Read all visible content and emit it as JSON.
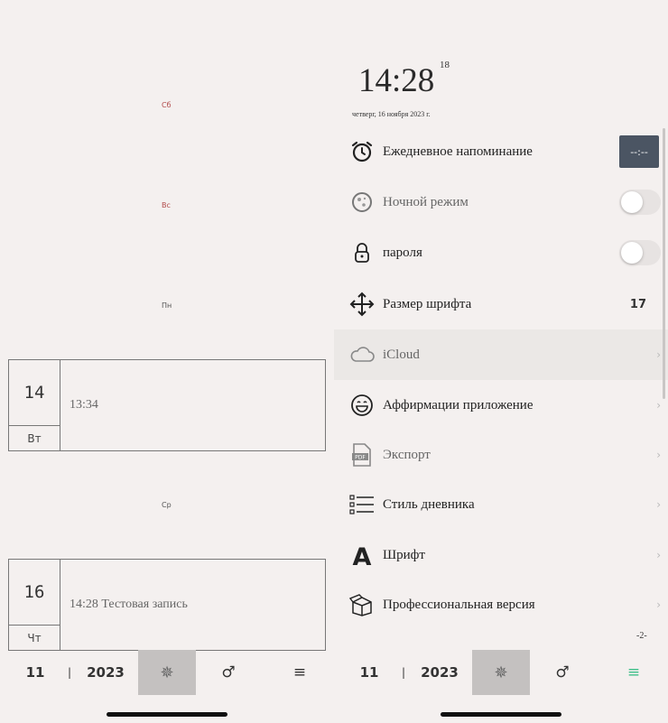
{
  "left": {
    "day_labels": [
      {
        "text": "Сб",
        "weekend": true
      },
      {
        "text": "Вс",
        "weekend": true
      },
      {
        "text": "Пн",
        "weekend": false
      },
      {
        "text": "Ср",
        "weekend": false
      }
    ],
    "entries": [
      {
        "day": "14",
        "weekday": "Вт",
        "text": "13:34"
      },
      {
        "day": "16",
        "weekday": "Чт",
        "text": "14:28 Тестовая запись"
      }
    ]
  },
  "bottom_bar": {
    "month": "11",
    "separator": "|",
    "year": "2023",
    "center_icon": "✵",
    "gender_icon": "♂",
    "menu_icon": "≡"
  },
  "right": {
    "clock": "14:28",
    "seconds": "18",
    "date": "четверг, 16 ноября 2023 г.",
    "settings": [
      {
        "label": "Ежедневное напоминание",
        "icon": "alarm-clock-icon",
        "control": "time",
        "value": "--:--"
      },
      {
        "label": "Ночной режим",
        "icon": "moon-icon",
        "control": "toggle",
        "on": false
      },
      {
        "label": "пароля",
        "icon": "lock-icon",
        "control": "toggle",
        "on": false
      },
      {
        "label": "Размер шрифта",
        "icon": "move-arrows-icon",
        "control": "value",
        "value": "17"
      },
      {
        "label": "iCloud",
        "icon": "cloud-icon",
        "control": "chevron"
      },
      {
        "label": "Аффирмации приложение",
        "icon": "smile-icon",
        "control": "chevron"
      },
      {
        "label": "Экспорт",
        "icon": "pdf-icon",
        "control": "chevron"
      },
      {
        "label": "Стиль дневника",
        "icon": "checklist-icon",
        "control": "chevron"
      },
      {
        "label": "Шрифт",
        "icon": "font-a-icon",
        "control": "chevron"
      },
      {
        "label": "Профессиональная версия",
        "icon": "box-icon",
        "control": "chevron"
      }
    ],
    "page_indicator": "-2-"
  },
  "colors": {
    "background": "#f4f0ef",
    "weekend": "#b24a4a",
    "time_button": "#4b5563",
    "active_menu": "#3fbf8a",
    "selected_tab": "#c4c1c0"
  }
}
